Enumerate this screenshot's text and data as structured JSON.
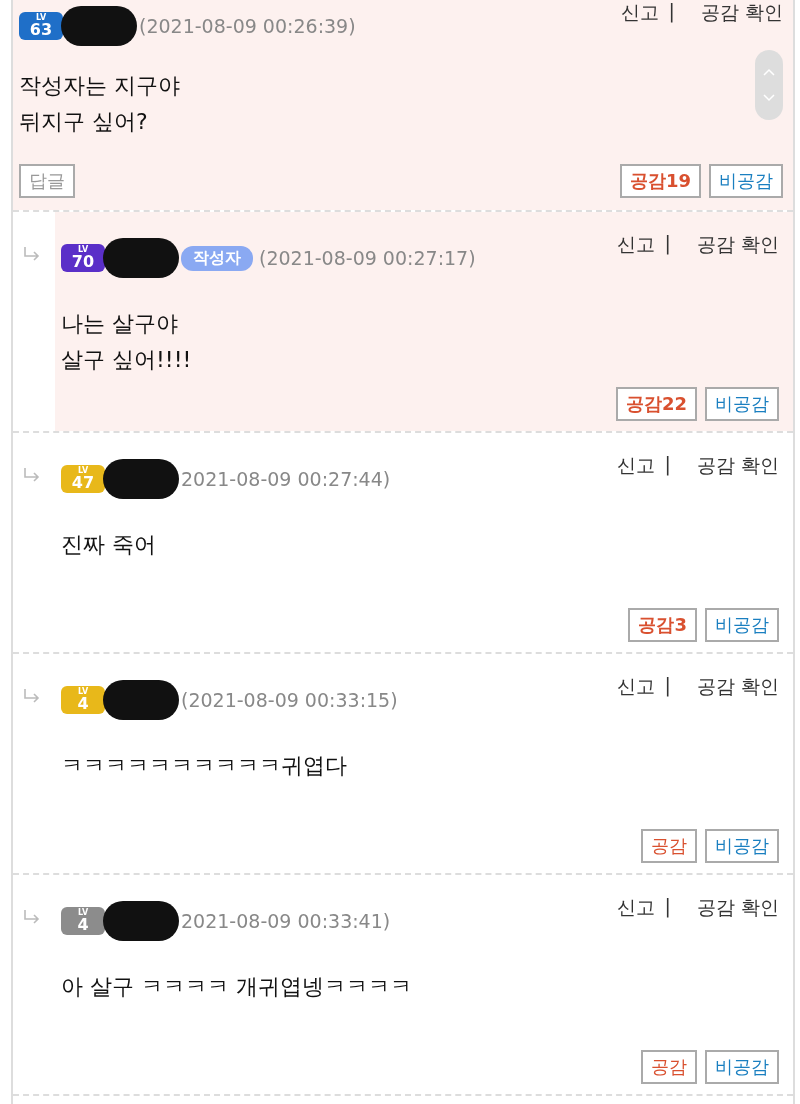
{
  "comments": [
    {
      "kind": "comment",
      "highlighted": true,
      "scroll_control": true,
      "badge": {
        "label": "LV",
        "number": "63",
        "color": "#1f6fc8"
      },
      "date": "(2021-08-09 00:26:39)",
      "report": "신고",
      "separator": "|",
      "likes_link": "공감 확인",
      "body": [
        "작성자는 지구야",
        "뒤지구 싶어?"
      ],
      "reply_button": "답글",
      "like": "공감",
      "like_count": "19",
      "dislike": "비공감"
    },
    {
      "kind": "reply",
      "highlighted": true,
      "badge": {
        "label": "LV",
        "number": "70",
        "color": "#5a2fc8"
      },
      "author_tag": "작성자",
      "date": "(2021-08-09 00:27:17)",
      "report": "신고",
      "separator": "|",
      "likes_link": "공감 확인",
      "body": [
        "나는 살구야",
        "살구 싶어!!!!"
      ],
      "like": "공감",
      "like_count": "22",
      "dislike": "비공감"
    },
    {
      "kind": "reply",
      "highlighted": false,
      "badge": {
        "label": "LV",
        "number": "47",
        "color": "#e8b81a"
      },
      "date": "2021-08-09 00:27:44)",
      "report": "신고",
      "separator": "|",
      "likes_link": "공감 확인",
      "body": [
        "진짜 죽어"
      ],
      "like": "공감",
      "like_count": "3",
      "dislike": "비공감"
    },
    {
      "kind": "reply",
      "highlighted": false,
      "badge": {
        "label": "LV",
        "number": "4",
        "color": "#e8b81a"
      },
      "date": "(2021-08-09 00:33:15)",
      "report": "신고",
      "separator": "|",
      "likes_link": "공감 확인",
      "body": [
        "ㅋㅋㅋㅋㅋㅋㅋㅋㅋㅋ귀엽다"
      ],
      "like": "공감",
      "dislike": "비공감"
    },
    {
      "kind": "reply",
      "highlighted": false,
      "badge": {
        "label": "LV",
        "number": "4",
        "color": "#8c8c8c"
      },
      "date": "2021-08-09 00:33:41)",
      "report": "신고",
      "separator": "|",
      "likes_link": "공감 확인",
      "body": [
        "아 살구 ㅋㅋㅋㅋ 개귀엽넹ㅋㅋㅋㅋ"
      ],
      "like": "공감",
      "dislike": "비공감"
    }
  ]
}
